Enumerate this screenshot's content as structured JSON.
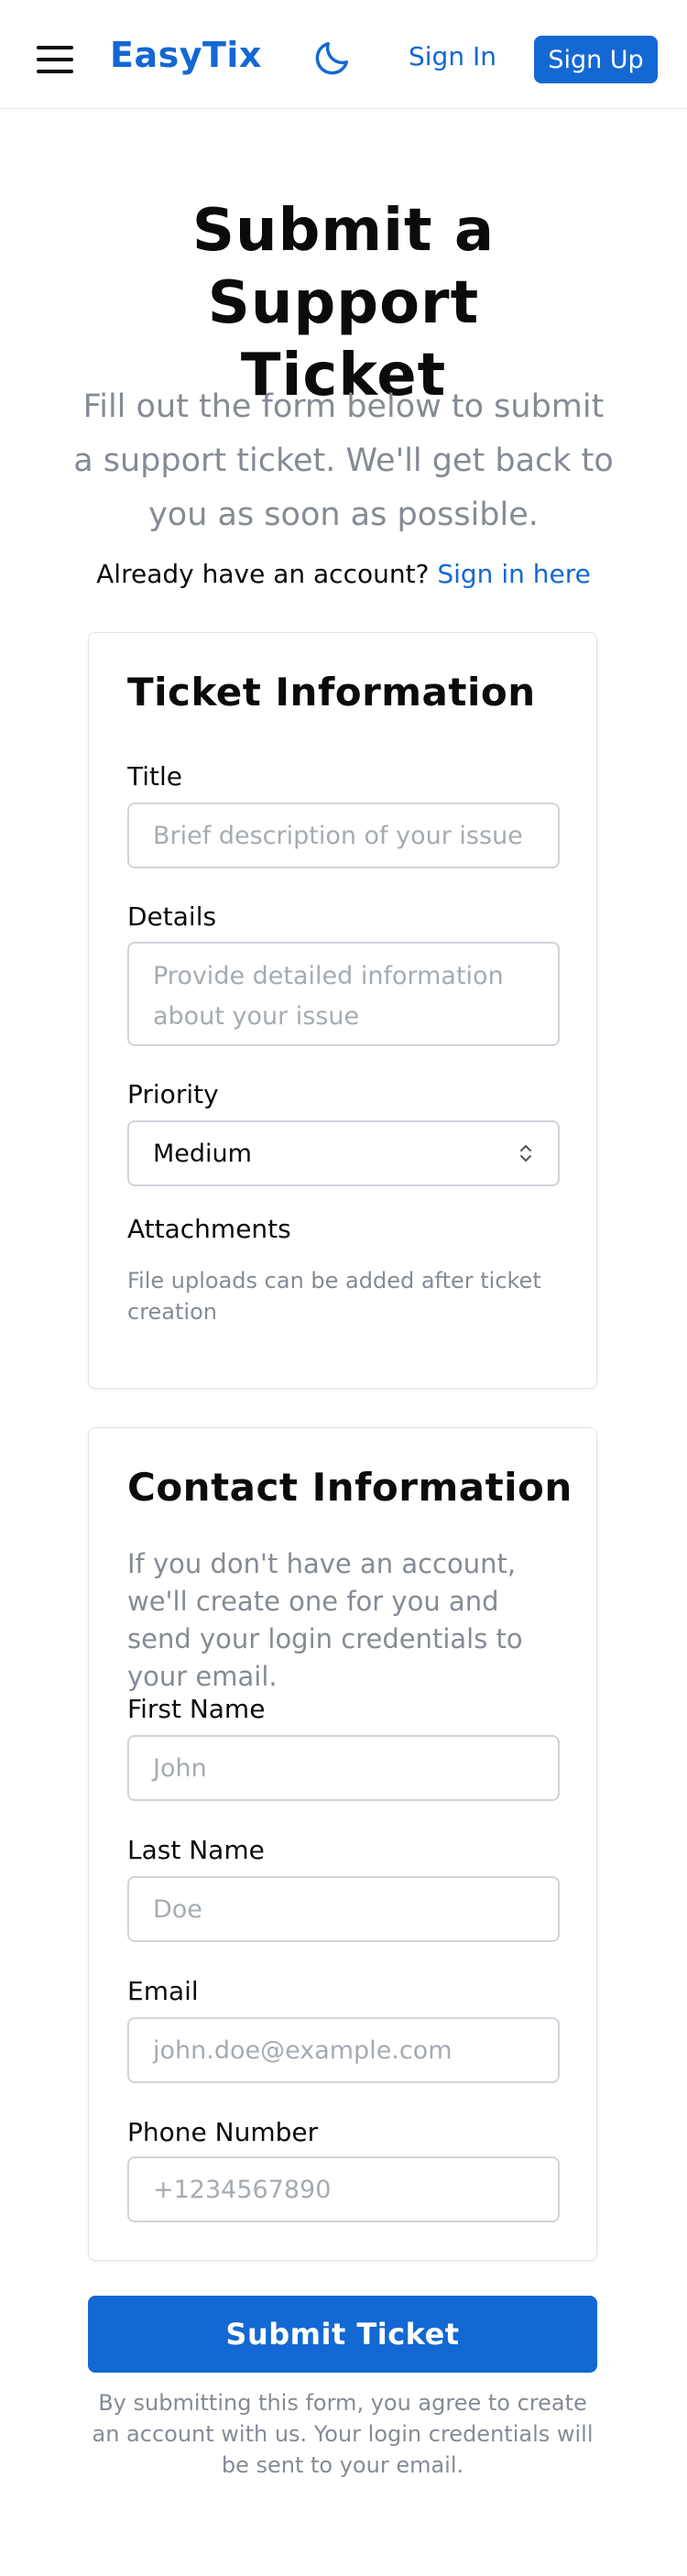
{
  "header": {
    "brand": "EasyTix",
    "menu_icon": "hamburger-menu-icon",
    "theme_icon": "moon-icon",
    "sign_in": "Sign In",
    "sign_up": "Sign Up"
  },
  "hero": {
    "title_line1": "Submit a Support",
    "title_line2": "Ticket",
    "subtitle": "Fill out the form below to submit a support ticket. We'll get back to you as soon as possible.",
    "login_prompt": "Already have an account?",
    "login_link": "Sign in here"
  },
  "ticket": {
    "heading": "Ticket Information",
    "title_label": "Title",
    "title_placeholder": "Brief description of your issue",
    "details_label": "Details",
    "details_placeholder": "Provide detailed information about your issue",
    "priority_label": "Priority",
    "priority_value": "Medium",
    "attachments_label": "Attachments",
    "attachments_help": "File uploads can be added after ticket creation"
  },
  "contact": {
    "heading": "Contact Information",
    "description": "If you don't have an account, we'll create one for you and send your login credentials to your email.",
    "first_name_label": "First Name",
    "first_name_placeholder": "John",
    "last_name_label": "Last Name",
    "last_name_placeholder": "Doe",
    "email_label": "Email",
    "email_placeholder": "john.doe@example.com",
    "phone_label": "Phone Number",
    "phone_placeholder": "+1234567890"
  },
  "submit_label": "Submit Ticket",
  "disclaimer": "By submitting this form, you agree to create an account with us. Your login credentials will be sent to your email.",
  "colors": {
    "accent": "#1368d3",
    "muted": "#858b95"
  }
}
